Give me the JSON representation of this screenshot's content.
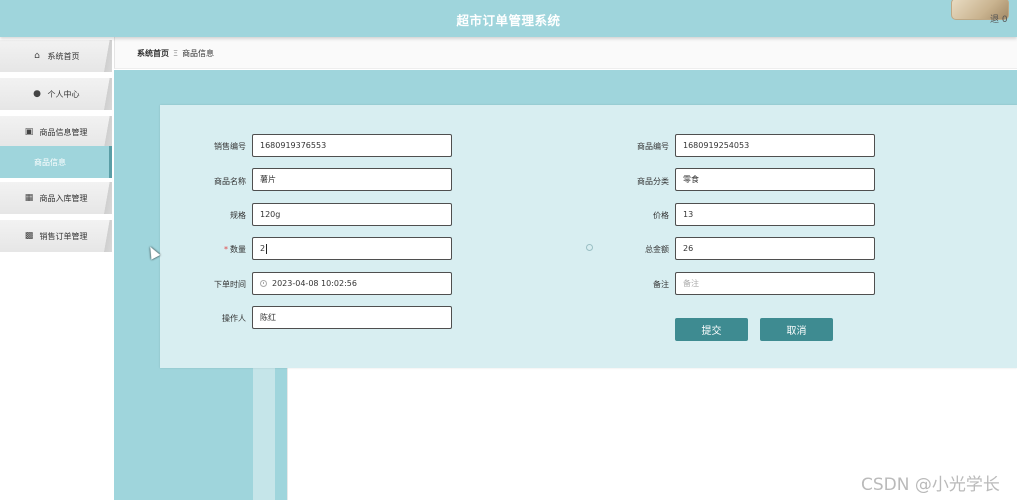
{
  "header": {
    "title": "超市订单管理系统",
    "user_text": "退 0"
  },
  "sidebar": {
    "items": [
      {
        "label": "系统首页",
        "icon": "home-icon"
      },
      {
        "label": "个人中心",
        "icon": "user-icon"
      },
      {
        "label": "商品信息管理",
        "icon": "monitor-icon"
      },
      {
        "label": "商品入库管理",
        "icon": "grid-icon"
      },
      {
        "label": "销售订单管理",
        "icon": "ticket-icon"
      }
    ],
    "sub_item": "商品信息"
  },
  "breadcrumb": {
    "home": "系统首页",
    "separator": "Ξ",
    "current": "商品信息"
  },
  "form": {
    "left": [
      {
        "label": "销售编号",
        "value": "1680919376553"
      },
      {
        "label": "商品名称",
        "value": "薯片"
      },
      {
        "label": "规格",
        "value": "120g"
      },
      {
        "label": "数量",
        "value": "2",
        "required": true
      },
      {
        "label": "下单时间",
        "value": "2023-04-08 10:02:56"
      },
      {
        "label": "操作人",
        "value": "陈红"
      }
    ],
    "right": [
      {
        "label": "商品编号",
        "value": "1680919254053"
      },
      {
        "label": "商品分类",
        "value": "零食"
      },
      {
        "label": "价格",
        "value": "13"
      },
      {
        "label": "总金额",
        "value": "26"
      },
      {
        "label": "备注",
        "placeholder": "备注"
      }
    ],
    "submit": "提交",
    "cancel": "取消"
  },
  "colors": {
    "header": "#9fd5dc",
    "button": "#3e8b91",
    "card": "#d8eef1"
  },
  "watermark": "CSDN @小光学长"
}
